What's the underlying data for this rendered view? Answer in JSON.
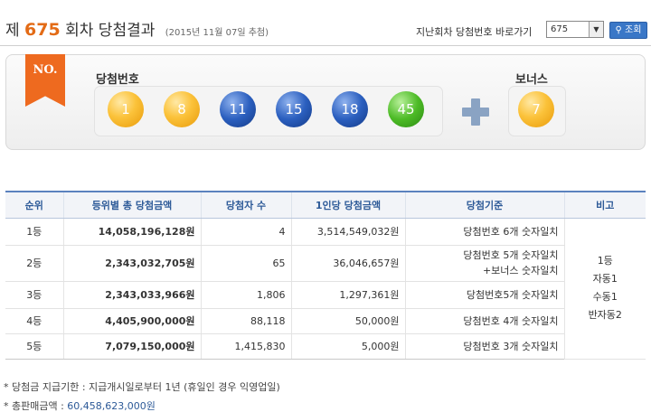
{
  "header": {
    "prefix": "제",
    "round": "675",
    "suffix": "회차 당첨결과",
    "date": "(2015년 11월 07일 추첨)",
    "goto_label": "지난회차 당첨번호 바로가기",
    "select_value": "675",
    "search_label": "조회"
  },
  "draw": {
    "badge": "NO.",
    "win_label": "당첨번호",
    "bonus_label": "보너스",
    "balls": [
      "1",
      "8",
      "11",
      "15",
      "18",
      "45"
    ],
    "bonus": "7",
    "colors": {
      "yellow": "#fbc23a",
      "blue": "#2b5fbf",
      "green": "#4dbb26"
    }
  },
  "table": {
    "headers": [
      "순위",
      "등위별 총 당첨금액",
      "당첨자 수",
      "1인당 당첨금액",
      "당첨기준",
      "비고"
    ],
    "rows": [
      {
        "rank": "1등",
        "total": "14,058,196,128원",
        "winners": "4",
        "per": "3,514,549,032원",
        "criteria": [
          "당첨번호 6개 숫자일치"
        ]
      },
      {
        "rank": "2등",
        "total": "2,343,032,705원",
        "winners": "65",
        "per": "36,046,657원",
        "criteria": [
          "당첨번호 5개 숫자일치",
          "+보너스 숫자일치"
        ]
      },
      {
        "rank": "3등",
        "total": "2,343,033,966원",
        "winners": "1,806",
        "per": "1,297,361원",
        "criteria": [
          "당첨번호5개 숫자일치"
        ]
      },
      {
        "rank": "4등",
        "total": "4,405,900,000원",
        "winners": "88,118",
        "per": "50,000원",
        "criteria": [
          "당첨번호 4개 숫자일치"
        ]
      },
      {
        "rank": "5등",
        "total": "7,079,150,000원",
        "winners": "1,415,830",
        "per": "5,000원",
        "criteria": [
          "당첨번호 3개 숫자일치"
        ]
      }
    ],
    "remarks": [
      "1등",
      "자동1",
      "수동1",
      "반자동2"
    ]
  },
  "notes": {
    "deadline": "* 당첨금 지급기한 : 지급개시일로부터 1년 (휴일인 경우 익영업일)",
    "sales_label": "* 총판매금액 : ",
    "sales_value": "60,458,623,000원"
  }
}
